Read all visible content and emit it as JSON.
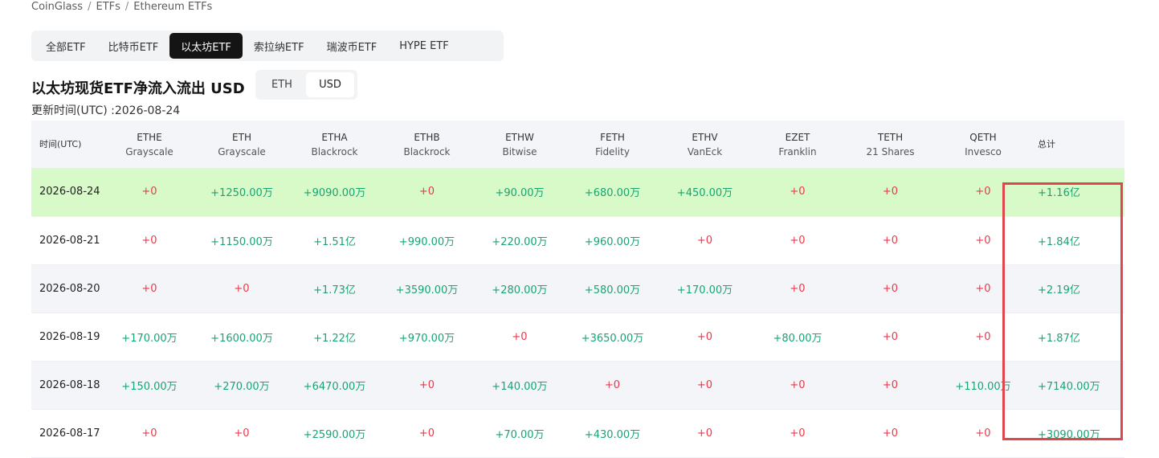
{
  "breadcrumb": [
    "CoinGlass",
    "ETFs",
    "Ethereum ETFs"
  ],
  "tabs": [
    {
      "label": "全部ETF",
      "active": false
    },
    {
      "label": "比特币ETF",
      "active": false
    },
    {
      "label": "以太坊ETF",
      "active": true
    },
    {
      "label": "索拉纳ETF",
      "active": false
    },
    {
      "label": "瑞波币ETF",
      "active": false
    },
    {
      "label": "HYPE ETF",
      "active": false
    }
  ],
  "title": "以太坊现货ETF净流入流出 USD",
  "unit_toggle": [
    {
      "label": "ETH",
      "active": false
    },
    {
      "label": "USD",
      "active": true
    }
  ],
  "updated": "更新时间(UTC) :2026-08-24",
  "table": {
    "date_header": "时间(UTC)",
    "total_header": "总计",
    "columns": [
      {
        "ticker": "ETHE",
        "issuer": "Grayscale"
      },
      {
        "ticker": "ETH",
        "issuer": "Grayscale"
      },
      {
        "ticker": "ETHA",
        "issuer": "Blackrock"
      },
      {
        "ticker": "ETHB",
        "issuer": "Blackrock"
      },
      {
        "ticker": "ETHW",
        "issuer": "Bitwise"
      },
      {
        "ticker": "FETH",
        "issuer": "Fidelity"
      },
      {
        "ticker": "ETHV",
        "issuer": "VanEck"
      },
      {
        "ticker": "EZET",
        "issuer": "Franklin"
      },
      {
        "ticker": "TETH",
        "issuer": "21 Shares"
      },
      {
        "ticker": "QETH",
        "issuer": "Invesco"
      }
    ],
    "rows": [
      {
        "date": "2026-08-24",
        "values": [
          "+0",
          "+1250.00万",
          "+9090.00万",
          "+0",
          "+90.00万",
          "+680.00万",
          "+450.00万",
          "+0",
          "+0",
          "+0"
        ],
        "total": "+1.16亿"
      },
      {
        "date": "2026-08-21",
        "values": [
          "+0",
          "+1150.00万",
          "+1.51亿",
          "+990.00万",
          "+220.00万",
          "+960.00万",
          "+0",
          "+0",
          "+0",
          "+0"
        ],
        "total": "+1.84亿"
      },
      {
        "date": "2026-08-20",
        "values": [
          "+0",
          "+0",
          "+1.73亿",
          "+3590.00万",
          "+280.00万",
          "+580.00万",
          "+170.00万",
          "+0",
          "+0",
          "+0"
        ],
        "total": "+2.19亿"
      },
      {
        "date": "2026-08-19",
        "values": [
          "+170.00万",
          "+1600.00万",
          "+1.22亿",
          "+970.00万",
          "+0",
          "+3650.00万",
          "+0",
          "+80.00万",
          "+0",
          "+0"
        ],
        "total": "+1.87亿"
      },
      {
        "date": "2026-08-18",
        "values": [
          "+150.00万",
          "+270.00万",
          "+6470.00万",
          "+0",
          "+140.00万",
          "+0",
          "+0",
          "+0",
          "+0",
          "+110.00万"
        ],
        "total": "+7140.00万"
      },
      {
        "date": "2026-08-17",
        "values": [
          "+0",
          "+0",
          "+2590.00万",
          "+0",
          "+70.00万",
          "+430.00万",
          "+0",
          "+0",
          "+0",
          "+0"
        ],
        "total": "+3090.00万"
      }
    ]
  },
  "colors": {
    "positive": "#16a671",
    "zero": "#e8394b",
    "highlight_row": "#d8f9c8",
    "annotation_box": "#e0474c"
  }
}
